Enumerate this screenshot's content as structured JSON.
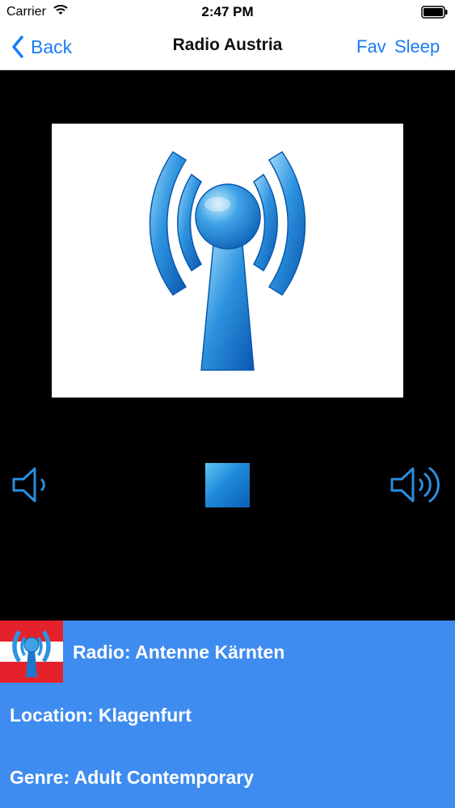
{
  "status": {
    "carrier": "Carrier",
    "time": "2:47 PM",
    "wifi_icon": "wifi-icon",
    "battery_icon": "battery-icon"
  },
  "nav": {
    "back_label": "Back",
    "title": "Radio Austria",
    "fav_label": "Fav",
    "sleep_label": "Sleep"
  },
  "player": {
    "artwork_icon": "radio-tower-icon",
    "controls": [
      "volume-down-icon",
      "stop-icon",
      "volume-up-icon"
    ]
  },
  "info": {
    "radio": "Radio: Antenne Kärnten",
    "location": "Location: Klagenfurt",
    "genre": "Genre: Adult Contemporary",
    "logo_icon": "austria-flag-radio-icon"
  },
  "colors": {
    "accent": "#1a7cf5",
    "panel": "#3f8cf0",
    "background": "#000000",
    "icon_blue": "#1f8ad9",
    "flag_red": "#e5222b"
  }
}
